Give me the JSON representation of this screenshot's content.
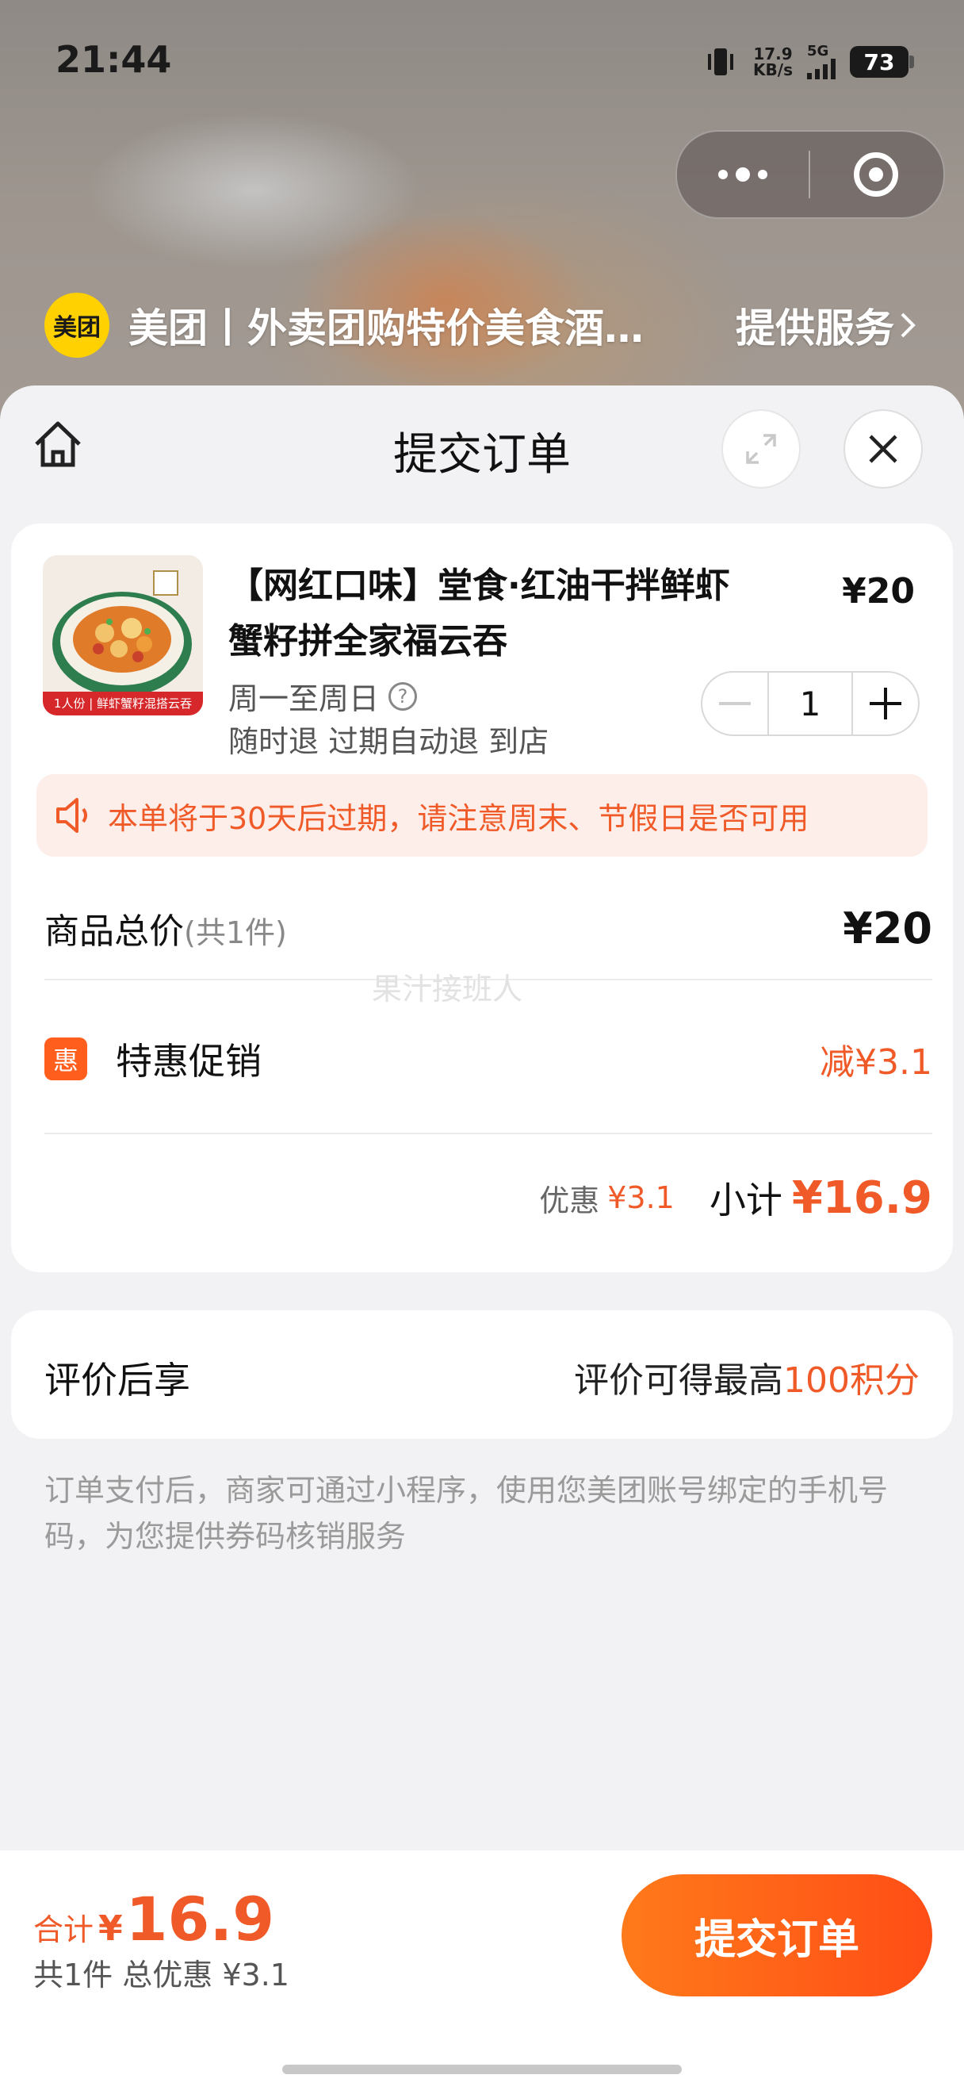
{
  "status_bar": {
    "time": "21:44",
    "net_speed_value": "17.9",
    "net_speed_unit": "KB/s",
    "network": "5G",
    "battery": "73"
  },
  "capsule": {
    "more_icon": "ellipsis-icon",
    "close_icon": "target-icon"
  },
  "merchant": {
    "logo_text": "美团",
    "name": "美团丨外卖团购特价美食酒…",
    "service_label": "提供服务"
  },
  "nav": {
    "title": "提交订单"
  },
  "product": {
    "title": "【网红口味】堂食·红油干拌鲜虾蟹籽拼全家福云吞",
    "price": "¥20",
    "days": "周一至周日",
    "rules": "随时退 过期自动退 到店",
    "quantity": "1",
    "thumb_tag": "1人份 | 鲜虾蟹籽混搭云吞"
  },
  "notice": {
    "text": "本单将于30天后过期，请注意周末、节假日是否可用"
  },
  "summary": {
    "total_label": "商品总价",
    "total_count": "(共1件)",
    "total_value": "¥20",
    "watermark": "果汁接班人",
    "promo_badge": "惠",
    "promo_label": "特惠促销",
    "promo_value": "减¥3.1",
    "discount_label": "优惠",
    "discount_value": "¥3.1",
    "subtotal_label": "小计",
    "subtotal_value": "¥16.9"
  },
  "review": {
    "label": "评价后享",
    "text_prefix": "评价可得最高",
    "text_highlight": "100积分"
  },
  "footnote": "订单支付后，商家可通过小程序，使用您美团账号绑定的手机号码，为您提供券码核销服务",
  "bottom": {
    "sum_label": "合计",
    "sum_currency": "¥",
    "sum_value": "16.9",
    "sum_detail": "共1件 总优惠 ¥3.1",
    "submit_label": "提交订单"
  },
  "colors": {
    "accent": "#f05a28",
    "brand_yellow": "#ffd100",
    "button_start": "#ff7a1a",
    "button_end": "#ff4d16"
  }
}
